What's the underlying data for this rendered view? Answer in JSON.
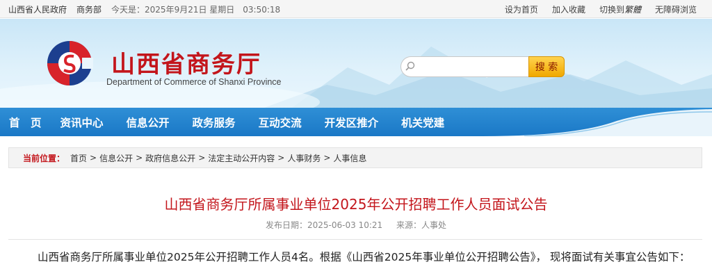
{
  "topbar": {
    "gov_link": "山西省人民政府",
    "dept_link": "商务部",
    "date": "今天是：2025年9月21日 星期日　03:50:18",
    "set_home": "设为首页",
    "add_fav": "加入收藏",
    "switch_text": "切换到",
    "switch_em": "繁體",
    "accessible": "无障碍浏览"
  },
  "header": {
    "title": "山西省商务厅",
    "subtitle": "Department of Commerce of Shanxi Province",
    "search_placeholder": "",
    "search_button": "搜 索"
  },
  "nav": {
    "items": [
      "首　页",
      "资讯中心",
      "信息公开",
      "政务服务",
      "互动交流",
      "开发区推介",
      "机关党建"
    ]
  },
  "breadcrumb": {
    "label": "当前位置：",
    "items": [
      "首页",
      "信息公开",
      "政府信息公开",
      "法定主动公开内容",
      "人事财务",
      "人事信息"
    ]
  },
  "article": {
    "title": "山西省商务厅所属事业单位2025年公开招聘工作人员面试公告",
    "date_label": "发布日期：2025-06-03 10:21",
    "source_label": "来源：人事处",
    "paragraph": "山西省商务厅所属事业单位2025年公开招聘工作人员4名。根据《山西省2025年事业单位公开招聘公告》， 现将面试有关事宜公告如下："
  },
  "colors": {
    "brand_red": "#c3151b",
    "nav_blue": "#1a78c6",
    "search_orange": "#f0a800"
  }
}
